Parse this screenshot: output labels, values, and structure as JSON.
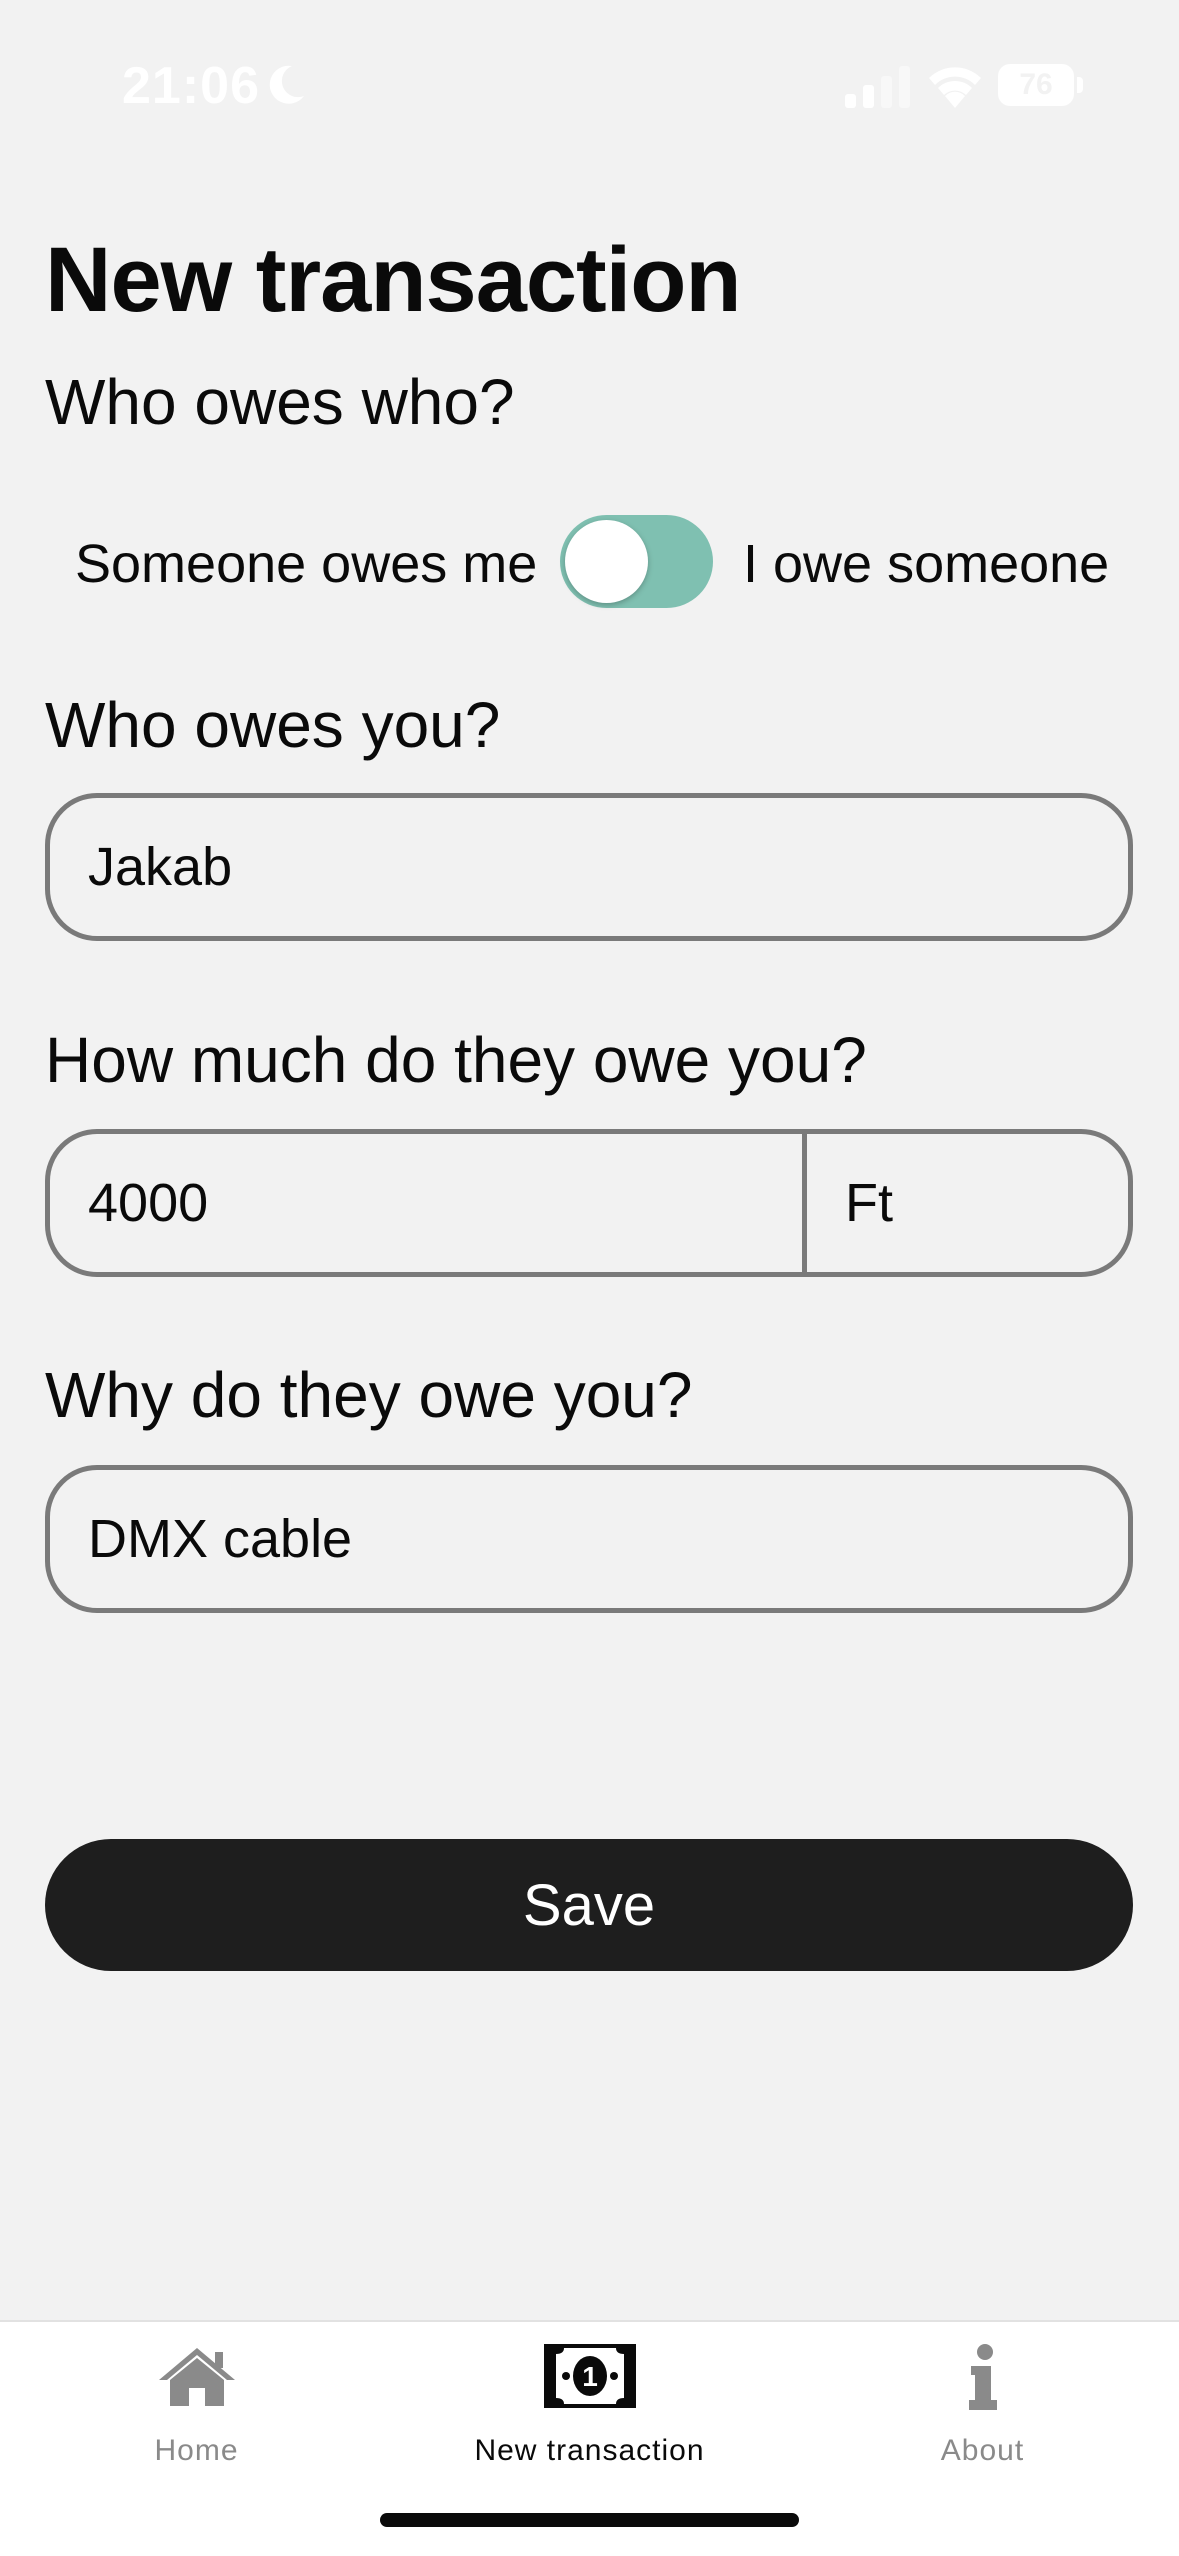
{
  "status_bar": {
    "time": "21:06",
    "battery": "76"
  },
  "page": {
    "title": "New transaction"
  },
  "direction": {
    "question": "Who owes who?",
    "left_option": "Someone owes me",
    "right_option": "I owe someone",
    "toggle_on": false,
    "accent_color": "#7fc0b1"
  },
  "person": {
    "question": "Who owes you?",
    "value": "Jakab"
  },
  "amount": {
    "question": "How much do they owe you?",
    "value": "4000",
    "currency": "Ft"
  },
  "reason": {
    "question": "Why do they owe you?",
    "value": "DMX cable"
  },
  "actions": {
    "save_label": "Save"
  },
  "tab_bar": {
    "tabs": [
      {
        "label": "Home",
        "icon": "home-icon",
        "active": false
      },
      {
        "label": "New transaction",
        "icon": "banknote-icon",
        "active": true
      },
      {
        "label": "About",
        "icon": "info-icon",
        "active": false
      }
    ]
  }
}
